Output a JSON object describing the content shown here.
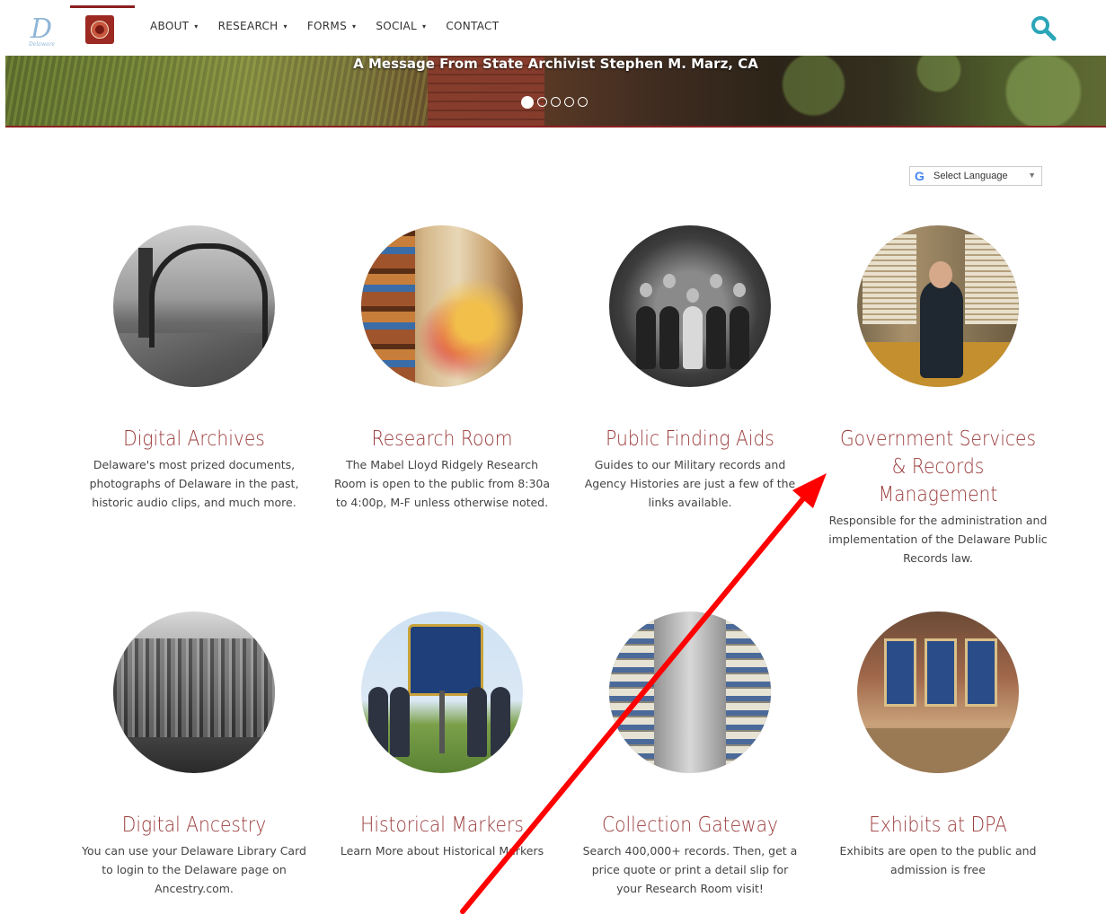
{
  "nav": {
    "menu": [
      {
        "label": "ABOUT",
        "caret": "▾"
      },
      {
        "label": "RESEARCH",
        "caret": "▾"
      },
      {
        "label": "FORMS",
        "caret": "▾"
      },
      {
        "label": "SOCIAL",
        "caret": "▾"
      },
      {
        "label": "CONTACT",
        "caret": ""
      }
    ],
    "search_icon": "search-icon"
  },
  "hero": {
    "title": "A Message From State Archivist Stephen M. Marz, CA",
    "slides_total": 5,
    "active_slide": 1
  },
  "language": {
    "g": "G",
    "label": "Select Language",
    "arrow": "▼"
  },
  "tiles": [
    {
      "title": "Digital Archives",
      "desc": "Delaware's most prized documents, photographs of Delaware in the past, historic audio clips, and much more."
    },
    {
      "title": "Research Room",
      "desc": "The Mabel Lloyd Ridgely Research Room is open to the public from 8:30a to 4:00p, M-F unless otherwise noted."
    },
    {
      "title": "Public Finding Aids",
      "desc": "Guides to our Military records and Agency Histories are just a few of the links available."
    },
    {
      "title": "Government Services & Records Management",
      "desc": "Responsible for the administration and implementation of the Delaware Public Records law."
    },
    {
      "title": "Digital Ancestry",
      "desc": "You can use your Delaware Library Card to login to the Delaware page on Ancestry.com."
    },
    {
      "title": "Historical Markers",
      "desc": "Learn More about Historical Markers"
    },
    {
      "title": "Collection Gateway",
      "desc": "Search 400,000+ records. Then, get a price quote or print a detail slip for your Research Room visit!"
    },
    {
      "title": "Exhibits at DPA",
      "desc": "Exhibits are open to the public and admission is free"
    }
  ],
  "colors": {
    "accent": "#8b1f1f",
    "title": "#9a3b3b",
    "search": "#2aa6b8",
    "annotation_arrow": "#ff0000"
  }
}
